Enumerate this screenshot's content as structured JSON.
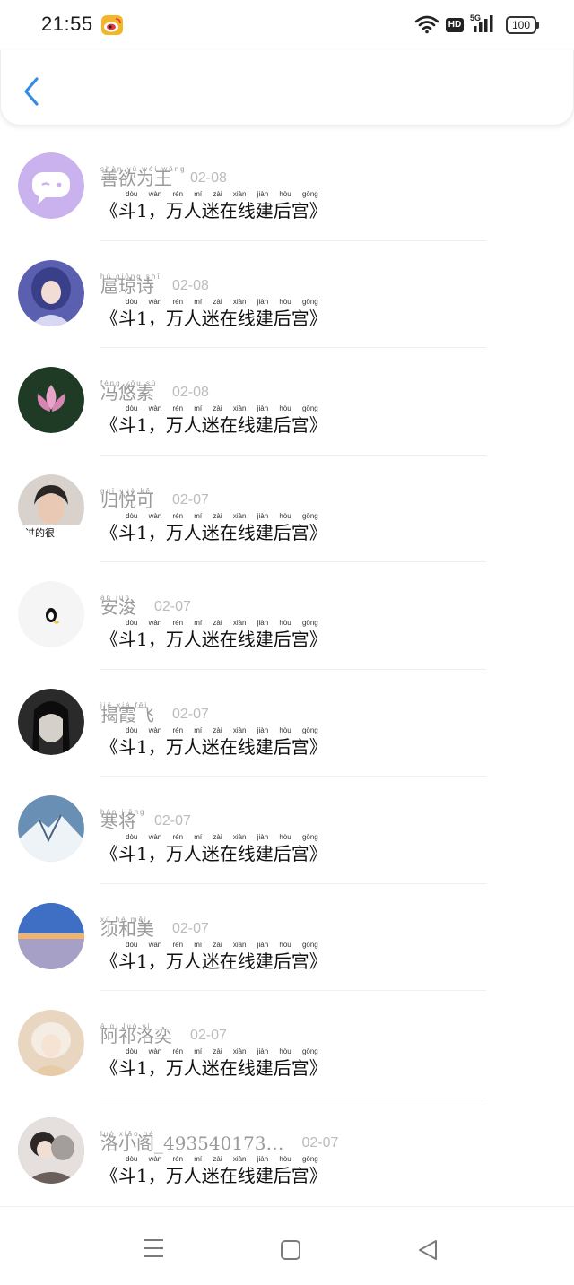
{
  "status_bar": {
    "time": "21:55",
    "hd": "HD",
    "network": "5G",
    "battery": "100"
  },
  "items": [
    {
      "pinyin": "shàn yù wéi wáng",
      "name": "善欲为王",
      "date": "02-08",
      "avatar_color": "#c9b2ee"
    },
    {
      "pinyin": "hú qióng shī",
      "name": "扈琼诗",
      "date": "02-08",
      "avatar_color": "#5a5fb0"
    },
    {
      "pinyin": "féng yōu sù",
      "name": "冯悠素",
      "date": "02-08",
      "avatar_color": "#1f3b26"
    },
    {
      "pinyin": "guī yuè kě",
      "name": "归悦可",
      "date": "02-07",
      "avatar_color": "#d9d2cc"
    },
    {
      "pinyin": "ān jùn",
      "name": "安浚",
      "date": "02-07",
      "avatar_color": "#f5f5f5"
    },
    {
      "pinyin": "jiē xiá fēi",
      "name": "揭霞飞",
      "date": "02-07",
      "avatar_color": "#2a2a2a"
    },
    {
      "pinyin": "hán jiāng",
      "name": "寒将",
      "date": "02-07",
      "avatar_color": "#6a8fb4"
    },
    {
      "pinyin": "xū hé měi",
      "name": "须和美",
      "date": "02-07",
      "avatar_color": "#5b73b8"
    },
    {
      "pinyin": "ā qí luò yì",
      "name": "阿祁洛奕",
      "date": "02-07",
      "avatar_color": "#e8d6c0"
    },
    {
      "pinyin": "luò xiǎo gé",
      "name": "洛小阁_493540173…",
      "date": "02-07",
      "avatar_color": "#7d7370"
    }
  ],
  "message": {
    "pinyin": "dòu wàn rén mí zài xiàn jiàn hòu gōng",
    "text": "《斗1，万人迷在线建后宫》"
  },
  "avatar_badge_text": "过的很"
}
